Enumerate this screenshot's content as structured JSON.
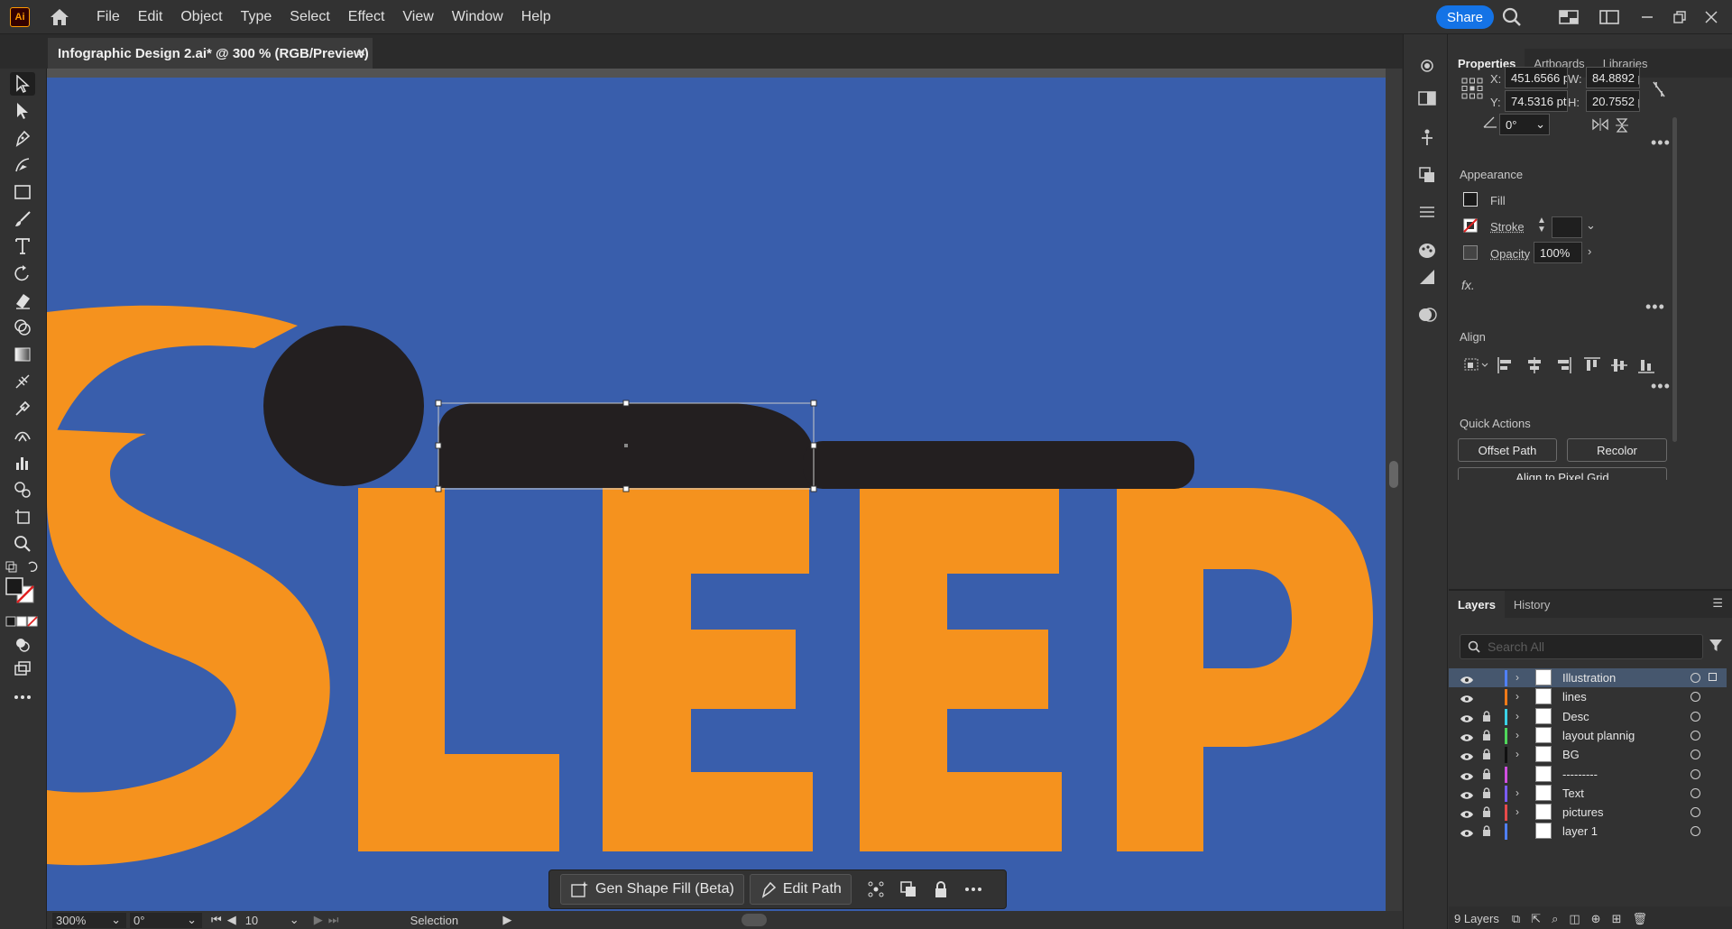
{
  "app": {
    "logo_text": "Ai"
  },
  "menu": [
    "File",
    "Edit",
    "Object",
    "Type",
    "Select",
    "Effect",
    "View",
    "Window",
    "Help"
  ],
  "share_label": "Share",
  "document_tab": {
    "title": "Infographic Design 2.ai* @ 300 % (RGB/Preview)",
    "close": "×"
  },
  "artwork": {
    "text": "SLEEP",
    "background_color": "#395eac",
    "letter_color": "#f5921e",
    "figure_color": "#231f20"
  },
  "taskbar": {
    "gen_shape_fill": "Gen Shape Fill (Beta)",
    "edit_path": "Edit Path"
  },
  "status": {
    "zoom": "300%",
    "rotation": "0°",
    "artboard": "10",
    "tool": "Selection"
  },
  "properties": {
    "tabs": [
      "Properties",
      "Artboards",
      "Libraries"
    ],
    "x_label": "X:",
    "x_value": "451.6566 pt",
    "y_label": "Y:",
    "y_value": "74.5316 pt",
    "w_label": "W:",
    "w_value": "84.8892 pt",
    "h_label": "H:",
    "h_value": "20.7552 pt",
    "angle_value": "0°",
    "appearance_title": "Appearance",
    "fill_label": "Fill",
    "stroke_label": "Stroke",
    "opacity_label": "Opacity",
    "opacity_value": "100%",
    "fx_label": "fx.",
    "align_title": "Align",
    "quick_actions_title": "Quick Actions",
    "offset_path": "Offset Path",
    "recolor": "Recolor",
    "align_pixel_grid": "Align to Pixel Grid"
  },
  "layers_panel": {
    "tabs": [
      "Layers",
      "History"
    ],
    "search_placeholder": "Search All",
    "layers": [
      {
        "name": "Illustration",
        "color": "#4f80ff",
        "locked": false,
        "expandable": true
      },
      {
        "name": "lines",
        "color": "#f07a19",
        "locked": false,
        "expandable": true
      },
      {
        "name": "Desc",
        "color": "#3ad1e6",
        "locked": true,
        "expandable": true
      },
      {
        "name": "layout plannig",
        "color": "#4fd65a",
        "locked": true,
        "expandable": true
      },
      {
        "name": "BG",
        "color": "#111111",
        "locked": true,
        "expandable": true
      },
      {
        "name": "---------",
        "color": "#d14fe0",
        "locked": true,
        "expandable": false
      },
      {
        "name": "Text",
        "color": "#7a5cff",
        "locked": true,
        "expandable": true
      },
      {
        "name": "pictures",
        "color": "#e84a4a",
        "locked": true,
        "expandable": true
      },
      {
        "name": "layer 1",
        "color": "#4f80ff",
        "locked": true,
        "expandable": false
      }
    ],
    "footer_count": "9 Layers"
  }
}
